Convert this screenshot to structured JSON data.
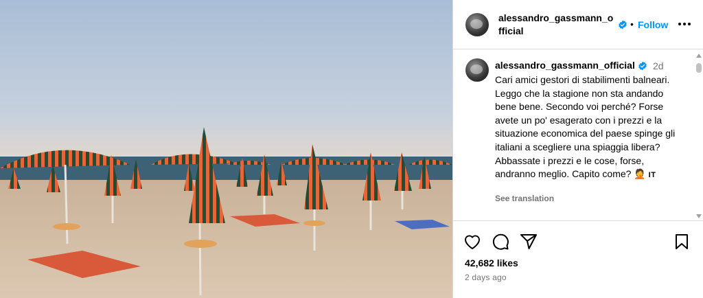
{
  "post": {
    "image_alt": "beach with striped umbrellas",
    "header": {
      "username": "alessandro_gassmann_official",
      "follow_separator": "•",
      "follow_label": "Follow"
    },
    "caption": {
      "username": "alessandro_gassmann_official",
      "time_ago": "2d",
      "text": "Cari amici gestori di stabilimenti balneari. Leggo che la stagione non sta andando bene bene. Secondo voi perché? Forse avete un po' esagerato con i prezzi e la situazione economica del paese spinge gli italiani a scegliere una spiaggia libera? Abbassate i prezzi e le cose, forse, andranno meglio. Capito come? ",
      "emoji": "🤦",
      "flag_tag": "IT",
      "see_translation": "See translation"
    },
    "likes": "42,682 likes",
    "date": "2 days ago"
  },
  "icons": {
    "verified": "verified-badge-icon",
    "more": "more-options-icon",
    "like": "heart-icon",
    "comment": "comment-icon",
    "share": "share-icon",
    "save": "bookmark-icon"
  },
  "colors": {
    "follow": "#0095f6",
    "verified": "#0095f6",
    "secondary_text": "#737373",
    "border": "#dbdbdb"
  }
}
